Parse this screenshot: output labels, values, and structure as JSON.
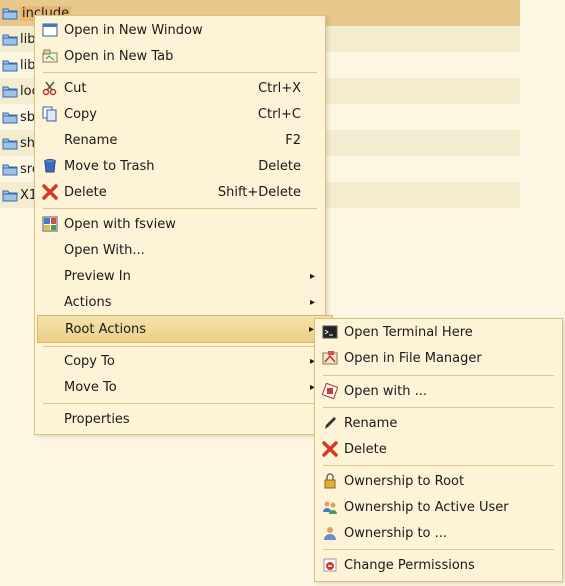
{
  "files": [
    {
      "name": "include"
    },
    {
      "name": "lib"
    },
    {
      "name": "lib"
    },
    {
      "name": "loc"
    },
    {
      "name": "sb"
    },
    {
      "name": "sh"
    },
    {
      "name": "src"
    },
    {
      "name": "X1"
    }
  ],
  "main_menu": {
    "open_new_window": "Open in New Window",
    "open_new_tab": "Open in New Tab",
    "cut": "Cut",
    "cut_sc": "Ctrl+X",
    "copy": "Copy",
    "copy_sc": "Ctrl+C",
    "rename": "Rename",
    "rename_sc": "F2",
    "move_trash": "Move to Trash",
    "move_trash_sc": "Delete",
    "delete": "Delete",
    "delete_sc": "Shift+Delete",
    "open_fsview": "Open with fsview",
    "open_with": "Open With...",
    "preview_in": "Preview In",
    "actions": "Actions",
    "root_actions": "Root Actions",
    "copy_to": "Copy To",
    "move_to": "Move To",
    "properties": "Properties"
  },
  "sub_menu": {
    "open_terminal": "Open Terminal Here",
    "open_file_manager": "Open in File Manager",
    "open_with": "Open with ...",
    "rename": "Rename",
    "delete": "Delete",
    "own_root": "Ownership to Root",
    "own_active": "Ownership to Active User",
    "own_to": "Ownership to ...",
    "change_perms": "Change Permissions"
  },
  "colors": {
    "menu_bg": "#fdf3d6",
    "highlight": "#eccf86",
    "selected_file": "#e6b874"
  }
}
